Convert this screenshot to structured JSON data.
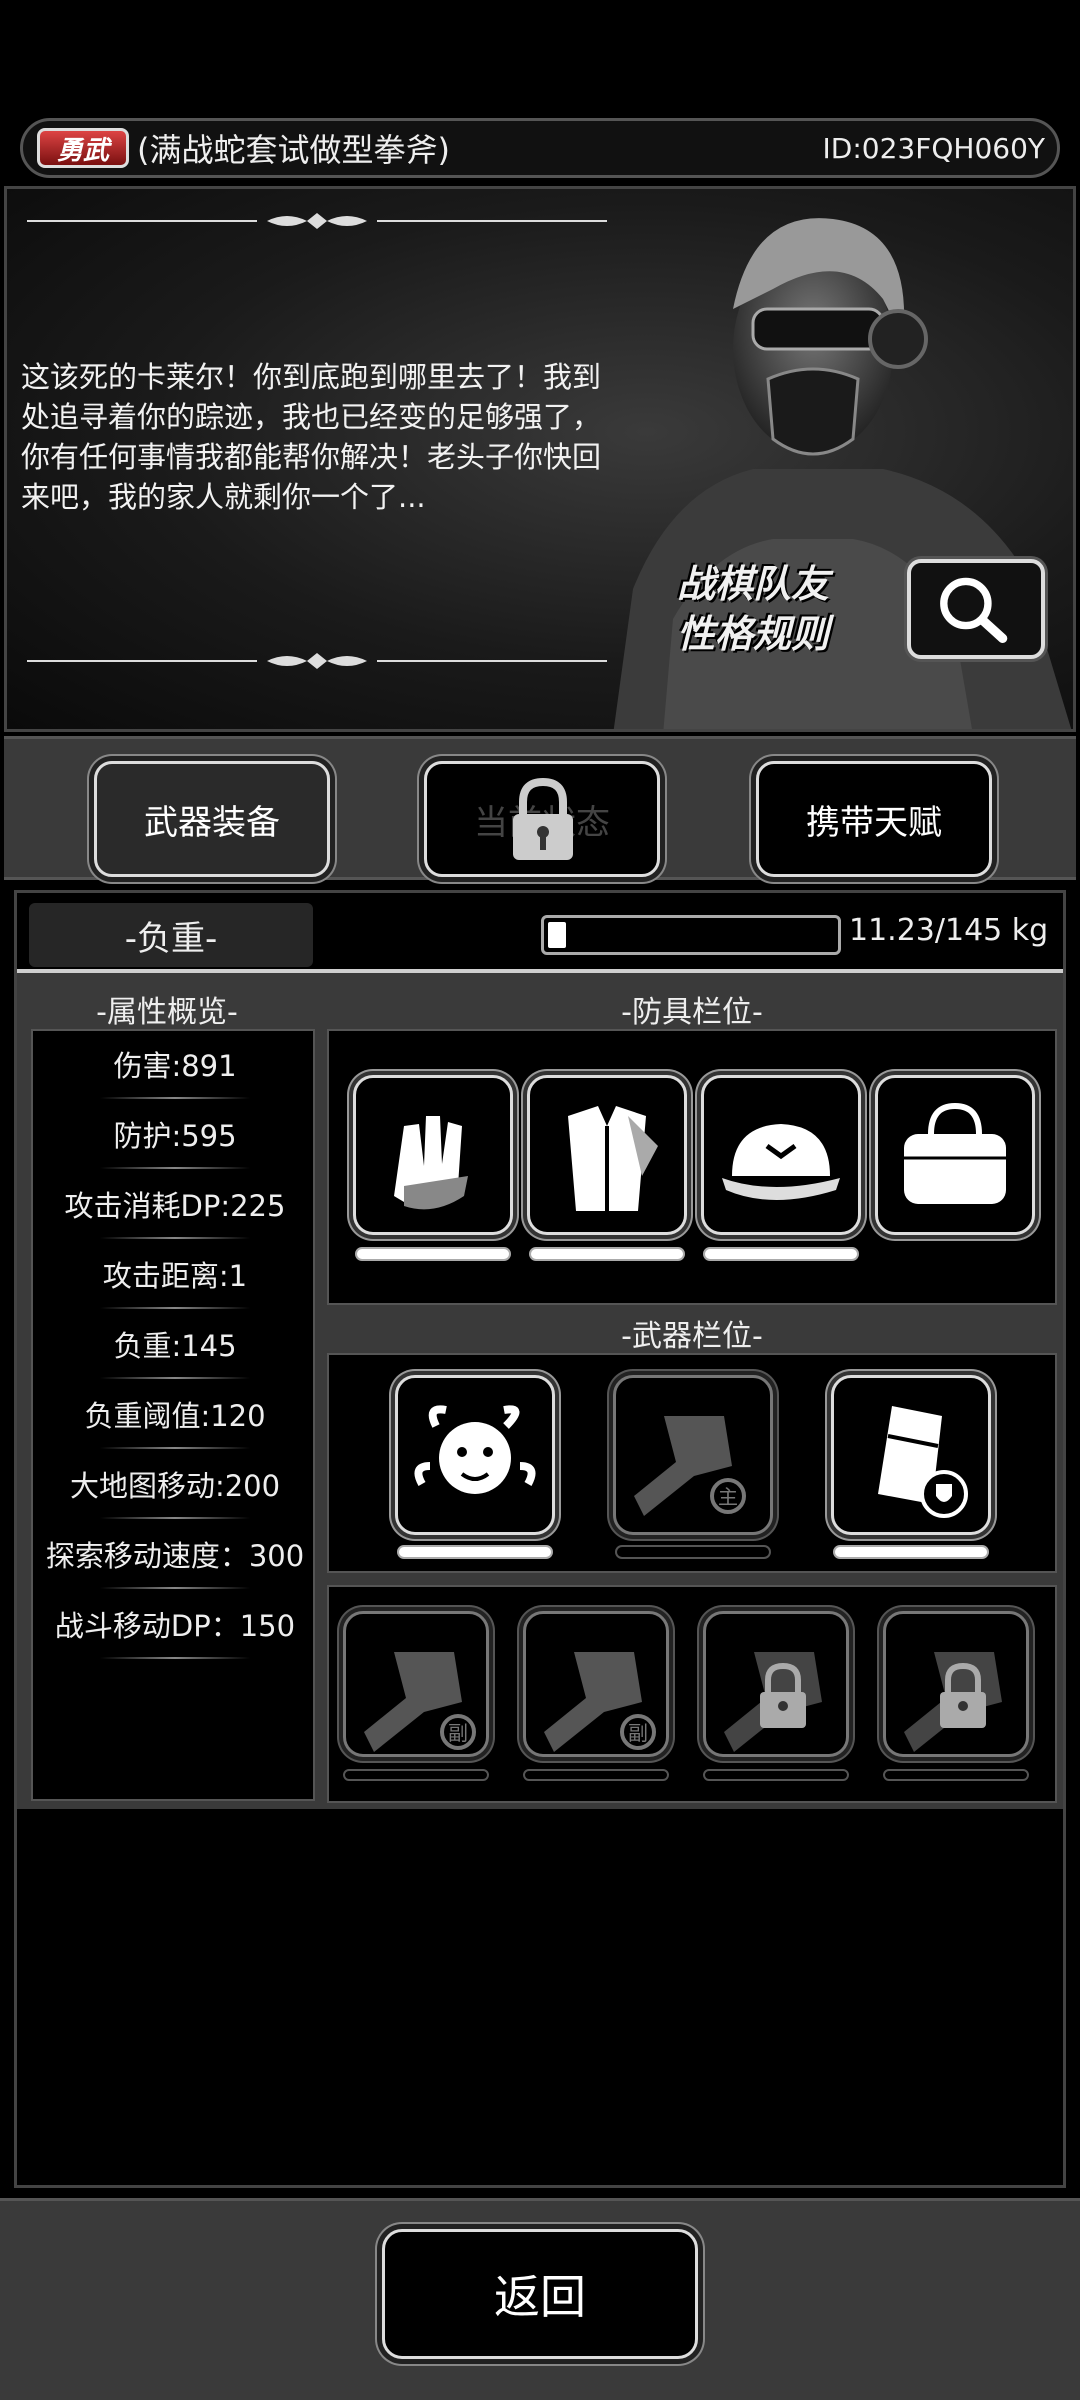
{
  "header": {
    "badge": "勇武",
    "title": "(满战蛇套试做型拳斧)",
    "uid": "ID:023FQH060Y"
  },
  "story": {
    "text": "这该死的卡莱尔！你到底跑到哪里去了！我到处追寻着你的踪迹，我也已经变的足够强了，你有任何事情我都能帮你解决！老头子你快回来吧，我的家人就剩你一个了...",
    "rules_line1": "战棋队友",
    "rules_line2": "性格规则"
  },
  "tabs": {
    "weapon_equipment": "武器装备",
    "current_state": "当前状态",
    "talent": "携带天赋"
  },
  "load": {
    "label": "-负重-",
    "value_text": "11.23/145 kg",
    "current": 11.23,
    "max": 145
  },
  "attributes": {
    "title": "-属性概览-",
    "items": [
      "伤害:891",
      "防护:595",
      "攻击消耗DP:225",
      "攻击距离:1",
      "负重:145",
      "负重阈值:120",
      "大地图移动:200",
      "探索移动速度：300",
      "战斗移动DP：150"
    ]
  },
  "armor": {
    "title": "-防具栏位-",
    "slots": [
      "gloves-icon",
      "coat-icon",
      "cap-icon",
      "bag-icon"
    ]
  },
  "weapons": {
    "title": "-武器栏位-",
    "slots": [
      "medusa-weapon-icon",
      "fist-main-icon",
      "backpack-shield-icon"
    ],
    "main_tag": "主",
    "sub_tag": "副",
    "extra_slots": [
      "fist-sub-icon",
      "fist-sub-icon",
      "locked-fist-icon",
      "locked-fist-icon"
    ]
  },
  "back_label": "返回"
}
